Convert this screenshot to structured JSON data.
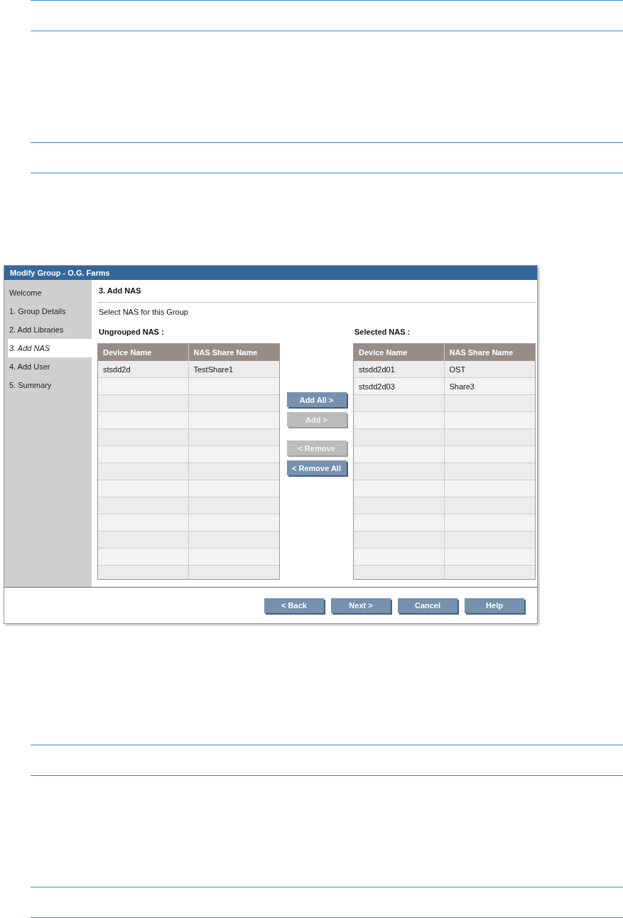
{
  "dialog": {
    "title": "Modify Group - O.G. Farms",
    "sidebar": {
      "items": [
        {
          "label": "Welcome",
          "selected": false
        },
        {
          "label": "1. Group Details",
          "selected": false
        },
        {
          "label": "2. Add Libraries",
          "selected": false
        },
        {
          "label": "3. Add NAS",
          "selected": true
        },
        {
          "label": "4. Add User",
          "selected": false
        },
        {
          "label": "5. Summary",
          "selected": false
        }
      ]
    },
    "section_title": "3. Add NAS",
    "instruction": "Select NAS for this Group",
    "ungrouped": {
      "label": "Ungrouped NAS :",
      "columns": [
        "Device Name",
        "NAS Share Name"
      ],
      "rows": [
        [
          "stsdd2d",
          "TestShare1"
        ]
      ]
    },
    "transfer_buttons": [
      {
        "label": "Add All >",
        "disabled": false
      },
      {
        "label": "Add >",
        "disabled": true
      },
      {
        "label": "< Remove",
        "disabled": true
      },
      {
        "label": "< Remove All",
        "disabled": false
      }
    ],
    "selected": {
      "label": "Selected NAS :",
      "columns": [
        "Device Name",
        "NAS Share Name"
      ],
      "rows": [
        [
          "stsdd2d01",
          "OST"
        ],
        [
          "stsdd2d03",
          "Share3"
        ]
      ]
    },
    "footer_buttons": [
      {
        "label": "< Back",
        "disabled": false
      },
      {
        "label": "Next >",
        "disabled": false
      },
      {
        "label": "Cancel",
        "disabled": false
      },
      {
        "label": "Help",
        "disabled": false
      }
    ]
  }
}
